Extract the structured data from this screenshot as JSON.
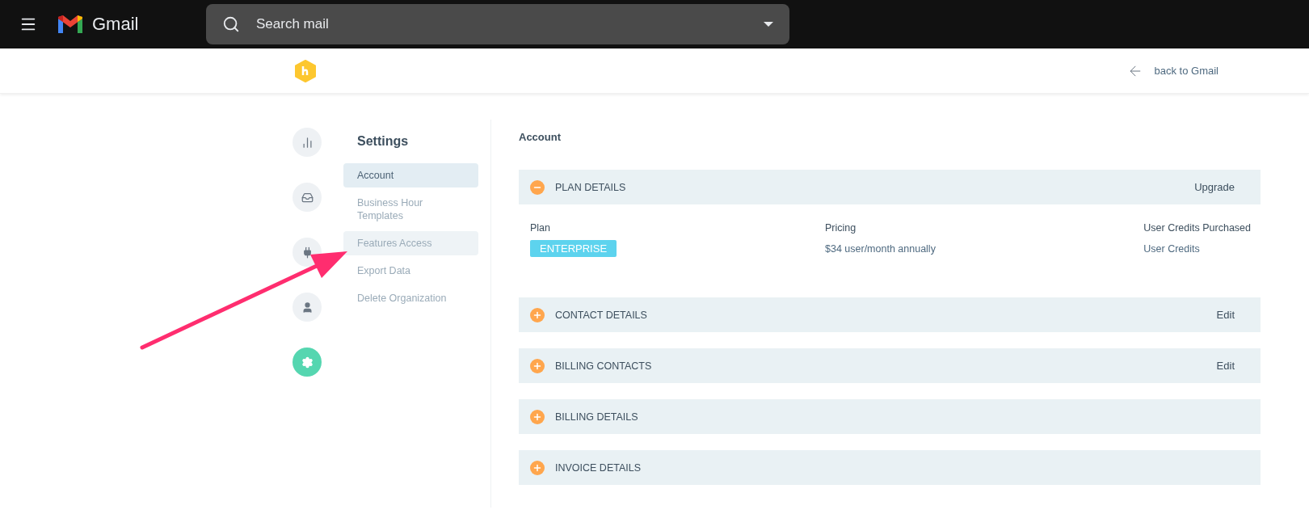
{
  "gmail_bar": {
    "brand": "Gmail",
    "search": {
      "placeholder": "Search mail"
    }
  },
  "header": {
    "back_link": "back to Gmail"
  },
  "rail": [
    {
      "selected": false
    },
    {
      "selected": false
    },
    {
      "selected": false
    },
    {
      "selected": false
    },
    {
      "selected": true
    }
  ],
  "settings_nav": {
    "title": "Settings",
    "items": [
      {
        "label": "Account",
        "selected": true,
        "hovered": false
      },
      {
        "label": "Business Hour Templates",
        "selected": false,
        "hovered": false
      },
      {
        "label": "Features Access",
        "selected": false,
        "hovered": true
      },
      {
        "label": "Export Data",
        "selected": false,
        "hovered": false
      },
      {
        "label": "Delete Organization",
        "selected": false,
        "hovered": false
      }
    ]
  },
  "content": {
    "title": "Account",
    "sections": [
      {
        "title": "PLAN DETAILS",
        "expanded": true,
        "action": "Upgrade",
        "details": {
          "columns": [
            {
              "label": "Plan",
              "value": "ENTERPRISE",
              "kind": "badge"
            },
            {
              "label": "Pricing",
              "value": "$34 user/month annually",
              "kind": "text"
            },
            {
              "label": "User Credits Purchased",
              "value": "User Credits",
              "kind": "text"
            }
          ]
        }
      },
      {
        "title": "CONTACT DETAILS",
        "expanded": false,
        "action": "Edit"
      },
      {
        "title": "BILLING CONTACTS",
        "expanded": false,
        "action": "Edit"
      },
      {
        "title": "BILLING DETAILS",
        "expanded": false
      },
      {
        "title": "INVOICE DETAILS",
        "expanded": false
      }
    ]
  },
  "annotation": {
    "kind": "arrow"
  }
}
